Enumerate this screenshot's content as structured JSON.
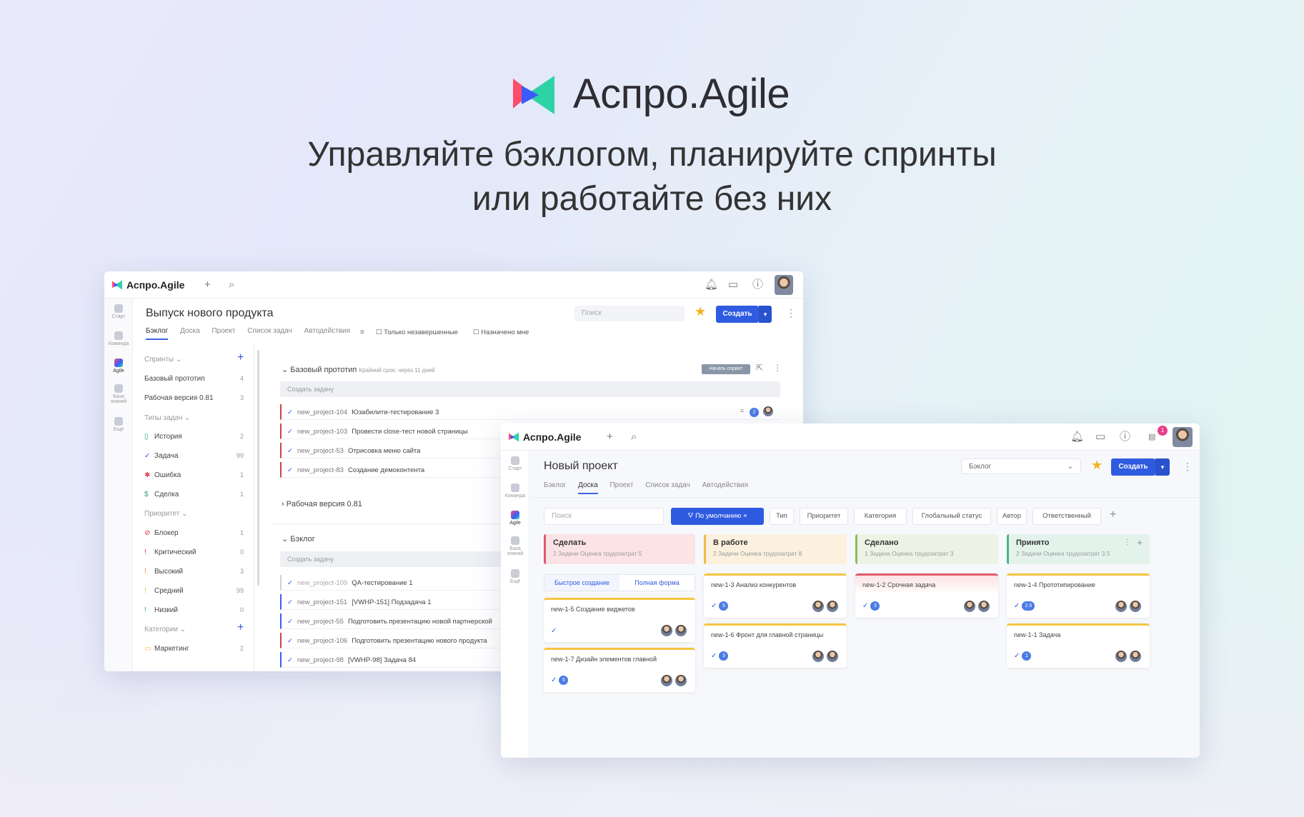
{
  "hero": {
    "brand": "Аспро.Agile",
    "title_line1": "Управляйте бэклогом, планируйте спринты",
    "title_line2": "или работайте без них"
  },
  "colors": {
    "accent": "#2f5be0",
    "star": "#f5b21c",
    "logo_red": "#ff4d6d",
    "logo_blue": "#3b5bff",
    "logo_green": "#2ed3a5"
  },
  "window1": {
    "brand": "Аспро.Agile",
    "rail": [
      "Старт",
      "Команда",
      "Agile",
      "База знаний",
      "Ещё"
    ],
    "title": "Выпуск нового продукта",
    "search_placeholder": "Поиск",
    "create": "Создать",
    "tabs": [
      "Бэклог",
      "Доска",
      "Проект",
      "Список задач",
      "Автодействия"
    ],
    "filters": [
      "Только незавершенные",
      "Назначено мне"
    ],
    "sidebar": {
      "sprints_head": "Спринты",
      "sprints": [
        {
          "label": "Базовый прототип",
          "count": "4"
        },
        {
          "label": "Рабочая версия 0.81",
          "count": "3"
        }
      ],
      "types_head": "Типы задач",
      "types": [
        {
          "icon": "bookmark-icon",
          "label": "История",
          "count": "2"
        },
        {
          "icon": "check-icon",
          "label": "Задача",
          "count": "99"
        },
        {
          "icon": "bug-icon",
          "label": "Ошибка",
          "count": "1"
        },
        {
          "icon": "dollar-icon",
          "label": "Сделка",
          "count": "1"
        }
      ],
      "priority_head": "Приоритет",
      "priorities": [
        {
          "icon": "blocker-icon",
          "label": "Блокер",
          "count": "1"
        },
        {
          "icon": "critical-icon",
          "label": "Критический",
          "count": "0"
        },
        {
          "icon": "high-icon",
          "label": "Высокий",
          "count": "3"
        },
        {
          "icon": "medium-icon",
          "label": "Средний",
          "count": "99"
        },
        {
          "icon": "low-icon",
          "label": "Низкий",
          "count": "0"
        }
      ],
      "categories_head": "Категории",
      "categories": [
        {
          "icon": "folder-icon",
          "label": "Маркетинг",
          "count": "2"
        }
      ]
    },
    "sprint1": {
      "title": "Базовый прототип",
      "deadline": "Крайний срок: через 11 дней",
      "start_btn": "Начать спринт",
      "create_task": "Создать задачу",
      "badge": "2",
      "tasks": [
        {
          "key": "new_project-104",
          "title": "Юзабилити-тестирование 3"
        },
        {
          "key": "new_project-103",
          "title": "Провести close-тест новой страницы"
        },
        {
          "key": "new_project-53",
          "title": "Отрисовка меню сайта"
        },
        {
          "key": "new_project-83",
          "title": "Создание демоконтента"
        }
      ]
    },
    "sprint2": {
      "title": "Рабочая версия 0.81"
    },
    "backlog": {
      "title": "Бэклог",
      "create_task": "Создать задачу",
      "tasks": [
        {
          "key": "new_project-109",
          "title": "QA-тестирование 1"
        },
        {
          "key": "new_project-151",
          "title": "[VWHP-151] Подзадача 1"
        },
        {
          "key": "new_project-55",
          "title": "Подготовить презентацию новой партнерской"
        },
        {
          "key": "new_project-106",
          "title": "Подготовить презентацию нового продукта"
        },
        {
          "key": "new_project-98",
          "title": "[VWHP-98] Задача 84"
        }
      ]
    }
  },
  "window2": {
    "brand": "Аспро.Agile",
    "notifications": "1",
    "rail": [
      "Старт",
      "Команда",
      "Agile",
      "База знаний",
      "Ещё"
    ],
    "title": "Новый проект",
    "view_select": "Бэклог",
    "create": "Создать",
    "tabs": [
      "Бэклог",
      "Доска",
      "Проект",
      "Список задач",
      "Автодействия"
    ],
    "search_placeholder": "Поиск",
    "filter_default": "По умолчанию",
    "filters": [
      "Тип",
      "Приоритет",
      "Категория",
      "Глобальный статус",
      "Автор",
      "Ответственный"
    ],
    "columns": [
      {
        "title": "Сделать",
        "meta": "2 Задачи   Оценка трудозатрат 5",
        "bg": "#fbe3e6",
        "edge": "#e05a6a"
      },
      {
        "title": "В работе",
        "meta": "2 Задачи   Оценка трудозатрат 8",
        "bg": "#fbf1de",
        "edge": "#f0b84a"
      },
      {
        "title": "Сделано",
        "meta": "1 Задача   Оценка трудозатрат 3",
        "bg": "#edf3e4",
        "edge": "#8bbd5a"
      },
      {
        "title": "Принято",
        "meta": "2 Задачи   Оценка трудозатрат 3.5",
        "bg": "#e3f3ec",
        "edge": "#42b883"
      }
    ],
    "quick_tabs": [
      "Быстрое создание",
      "Полная форма"
    ],
    "cards": {
      "todo": [
        {
          "title": "new-1-5 Создание виджетов",
          "est": ""
        },
        {
          "title": "new-1-7 Дизайн элементов главной",
          "est": "5"
        }
      ],
      "progress": [
        {
          "title": "new-1-3 Анализ конкурентов",
          "est": "5"
        },
        {
          "title": "new-1-6 Фронт для главной страницы",
          "est": "3"
        }
      ],
      "done": [
        {
          "title": "new-1-2 Срочная задача",
          "est": "3"
        }
      ],
      "accepted": [
        {
          "title": "new-1-4 Прототипирование",
          "est": "2.5"
        },
        {
          "title": "new-1-1 Задача",
          "est": "1"
        }
      ]
    }
  }
}
